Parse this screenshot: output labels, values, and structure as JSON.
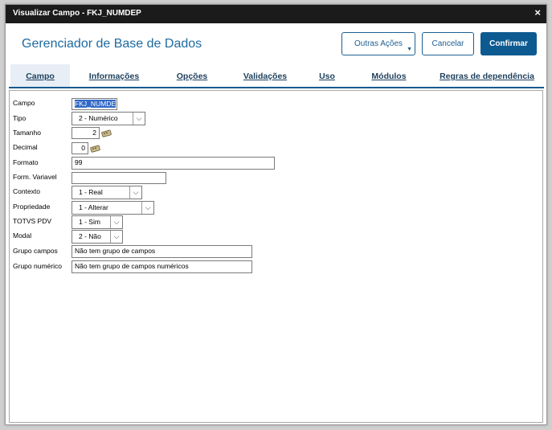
{
  "window": {
    "title": "Visualizar Campo - FKJ_NUMDEP",
    "close_glyph": "×"
  },
  "header": {
    "app_title": "Gerenciador de Base de Dados",
    "buttons": {
      "outras": "Outras Ações",
      "cancelar": "Cancelar",
      "confirmar": "Confirmar"
    },
    "dropdown_glyph": "▼"
  },
  "tabs": [
    {
      "label": "Campo",
      "active": true
    },
    {
      "label": "Informações",
      "active": false
    },
    {
      "label": "Opções",
      "active": false
    },
    {
      "label": "Validações",
      "active": false
    },
    {
      "label": "Uso",
      "active": false
    },
    {
      "label": "Módulos",
      "active": false
    },
    {
      "label": "Regras de dependência",
      "active": false
    }
  ],
  "form": {
    "campo": {
      "label": "Campo",
      "value": "FKJ_NUMDE"
    },
    "tipo": {
      "label": "Tipo",
      "value": "2 - Numérico"
    },
    "tamanho": {
      "label": "Tamanho",
      "value": "2"
    },
    "decimal": {
      "label": "Decimal",
      "value": "0"
    },
    "formato": {
      "label": "Formato",
      "value": "99"
    },
    "form_variavel": {
      "label": "Form. Variavel",
      "value": ""
    },
    "contexto": {
      "label": "Contexto",
      "value": "1 - Real"
    },
    "propriedade": {
      "label": "Propriedade",
      "value": "1 - Alterar"
    },
    "totvs_pdv": {
      "label": "TOTVS PDV",
      "value": "1 - Sim"
    },
    "modal": {
      "label": "Modal",
      "value": "2 - Não"
    },
    "grupo_campos": {
      "label": "Grupo campos",
      "value": "Não tem grupo de campos"
    },
    "grupo_numerico": {
      "label": "Grupo numérico",
      "value": "Não tem grupo de campos numéricos"
    }
  },
  "select_arrow_glyph": "⌵",
  "colors": {
    "titlebar": "#1b1b1b",
    "accent": "#0d5a91",
    "app_title": "#1d6aa0",
    "selection": "#3169c6"
  }
}
